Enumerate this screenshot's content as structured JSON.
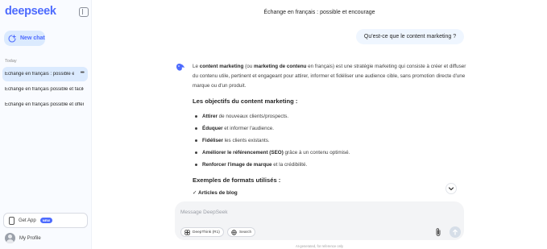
{
  "sidebar": {
    "logo": "deepseek",
    "new_chat_label": "New chat",
    "section_label": "Today",
    "history": [
      {
        "label": "Échange en français : possible et encourage",
        "active": true
      },
      {
        "label": "Échange en français possible et facile",
        "active": false
      },
      {
        "label": "Échange en français possible et offert",
        "active": false
      }
    ],
    "get_app_label": "Get App",
    "new_badge": "NEW",
    "profile_label": "My Profile"
  },
  "main": {
    "title": "Échange en français : possible et encourage",
    "user_message": "Qu'est-ce que le content marketing ?",
    "answer": {
      "intro": {
        "p1": "Le ",
        "b1": "content marketing",
        "p2": " (ou ",
        "b2": "marketing de contenu",
        "p3": " en français) est une stratégie marketing qui consiste à créer et diffuser du contenu utile, pertinent et engageant pour attirer, informer et fidéliser une audience cible, sans promotion directe d'une marque ou d'un produit."
      },
      "heading1": "Les objectifs du content marketing :",
      "objectives": [
        {
          "bold": "Attirer",
          "rest": " de nouveaux clients/prospects."
        },
        {
          "bold": "Éduquer",
          "rest": " et informer l'audience."
        },
        {
          "bold": "Fidéliser",
          "rest": " les clients existants."
        },
        {
          "bold": "Améliorer le référencement (SEO)",
          "rest": " grâce à un contenu optimisé."
        },
        {
          "bold": "Renforcer l'image de marque",
          "rest": " et la crédibilité."
        }
      ],
      "heading2": "Exemples de formats utilisés :",
      "format_first": "✓ Articles de blog"
    },
    "input": {
      "placeholder": "Message DeepSeek",
      "deepthink_label": "DeepThink (R1)",
      "search_label": "Search"
    },
    "disclaimer": "AI-generated, for reference only"
  },
  "colors": {
    "brand": "#4d6bfe",
    "sidebar_bg": "#f9fbff",
    "active_item": "#dbeafe",
    "user_bubble": "#eff6ff",
    "input_bg": "#f3f4f6"
  },
  "icons": [
    "collapse-sidebar-icon",
    "new-chat-icon",
    "more-icon",
    "phone-icon",
    "avatar",
    "deepseek-whale-icon",
    "chevron-down-icon",
    "deepthink-icon",
    "globe-icon",
    "paperclip-icon",
    "send-arrow-icon"
  ]
}
